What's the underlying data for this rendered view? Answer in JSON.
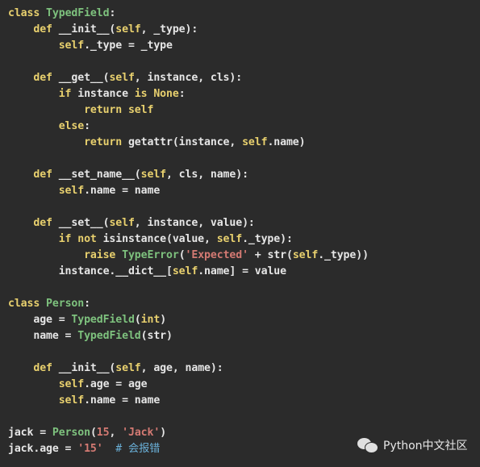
{
  "code": {
    "language": "python",
    "lines": [
      [
        {
          "t": "class ",
          "c": "kw"
        },
        {
          "t": "TypedField",
          "c": "cls"
        },
        {
          "t": ":",
          "c": ""
        }
      ],
      [
        {
          "t": "    def ",
          "c": "kw"
        },
        {
          "t": "__init__(",
          "c": ""
        },
        {
          "t": "self",
          "c": "self"
        },
        {
          "t": ", _type):",
          "c": ""
        }
      ],
      [
        {
          "t": "        ",
          "c": ""
        },
        {
          "t": "self",
          "c": "self"
        },
        {
          "t": "._type = _type",
          "c": ""
        }
      ],
      [],
      [
        {
          "t": "    def ",
          "c": "kw"
        },
        {
          "t": "__get__(",
          "c": ""
        },
        {
          "t": "self",
          "c": "self"
        },
        {
          "t": ", instance, cls):",
          "c": ""
        }
      ],
      [
        {
          "t": "        if ",
          "c": "kw"
        },
        {
          "t": "instance ",
          "c": ""
        },
        {
          "t": "is None",
          "c": "kw"
        },
        {
          "t": ":",
          "c": ""
        }
      ],
      [
        {
          "t": "            return self",
          "c": "kw"
        }
      ],
      [
        {
          "t": "        else",
          "c": "kw"
        },
        {
          "t": ":",
          "c": ""
        }
      ],
      [
        {
          "t": "            return ",
          "c": "kw"
        },
        {
          "t": "getattr(instance, ",
          "c": ""
        },
        {
          "t": "self",
          "c": "self"
        },
        {
          "t": ".name)",
          "c": ""
        }
      ],
      [],
      [
        {
          "t": "    def ",
          "c": "kw"
        },
        {
          "t": "__set_name__(",
          "c": ""
        },
        {
          "t": "self",
          "c": "self"
        },
        {
          "t": ", cls, name):",
          "c": ""
        }
      ],
      [
        {
          "t": "        ",
          "c": ""
        },
        {
          "t": "self",
          "c": "self"
        },
        {
          "t": ".name = name",
          "c": ""
        }
      ],
      [],
      [
        {
          "t": "    def ",
          "c": "kw"
        },
        {
          "t": "__set__(",
          "c": ""
        },
        {
          "t": "self",
          "c": "self"
        },
        {
          "t": ", instance, value):",
          "c": ""
        }
      ],
      [
        {
          "t": "        if not ",
          "c": "kw"
        },
        {
          "t": "isinstance(value, ",
          "c": ""
        },
        {
          "t": "self",
          "c": "self"
        },
        {
          "t": "._type):",
          "c": ""
        }
      ],
      [
        {
          "t": "            raise ",
          "c": "kw"
        },
        {
          "t": "TypeError",
          "c": "cls"
        },
        {
          "t": "(",
          "c": ""
        },
        {
          "t": "'Expected'",
          "c": "str"
        },
        {
          "t": " + str(",
          "c": ""
        },
        {
          "t": "self",
          "c": "self"
        },
        {
          "t": "._type))",
          "c": ""
        }
      ],
      [
        {
          "t": "        instance.__dict__[",
          "c": ""
        },
        {
          "t": "self",
          "c": "self"
        },
        {
          "t": ".name] = value",
          "c": ""
        }
      ],
      [],
      [
        {
          "t": "class ",
          "c": "kw"
        },
        {
          "t": "Person",
          "c": "cls"
        },
        {
          "t": ":",
          "c": ""
        }
      ],
      [
        {
          "t": "    age = ",
          "c": ""
        },
        {
          "t": "TypedField",
          "c": "cls"
        },
        {
          "t": "(",
          "c": ""
        },
        {
          "t": "int",
          "c": "kw"
        },
        {
          "t": ")",
          "c": ""
        }
      ],
      [
        {
          "t": "    name = ",
          "c": ""
        },
        {
          "t": "TypedField",
          "c": "cls"
        },
        {
          "t": "(str)",
          "c": ""
        }
      ],
      [],
      [
        {
          "t": "    def ",
          "c": "kw"
        },
        {
          "t": "__init__(",
          "c": ""
        },
        {
          "t": "self",
          "c": "self"
        },
        {
          "t": ", age, name):",
          "c": ""
        }
      ],
      [
        {
          "t": "        ",
          "c": ""
        },
        {
          "t": "self",
          "c": "self"
        },
        {
          "t": ".age = age",
          "c": ""
        }
      ],
      [
        {
          "t": "        ",
          "c": ""
        },
        {
          "t": "self",
          "c": "self"
        },
        {
          "t": ".name = name",
          "c": ""
        }
      ],
      [],
      [
        {
          "t": "jack = ",
          "c": ""
        },
        {
          "t": "Person",
          "c": "cls"
        },
        {
          "t": "(",
          "c": ""
        },
        {
          "t": "15",
          "c": "num"
        },
        {
          "t": ", ",
          "c": ""
        },
        {
          "t": "'Jack'",
          "c": "str"
        },
        {
          "t": ")",
          "c": ""
        }
      ],
      [
        {
          "t": "jack.age = ",
          "c": ""
        },
        {
          "t": "'15'",
          "c": "str"
        },
        {
          "t": "  ",
          "c": ""
        },
        {
          "t": "# 会报错",
          "c": "cmt"
        }
      ]
    ]
  },
  "watermark": {
    "icon": "wechat-icon",
    "text": "Python中文社区"
  },
  "colors": {
    "background": "#2b2b2b",
    "keyword": "#e8d06e",
    "class_name": "#7ec27e",
    "string": "#d47a73",
    "comment": "#6ab0d8",
    "default": "#e6e6e6"
  }
}
